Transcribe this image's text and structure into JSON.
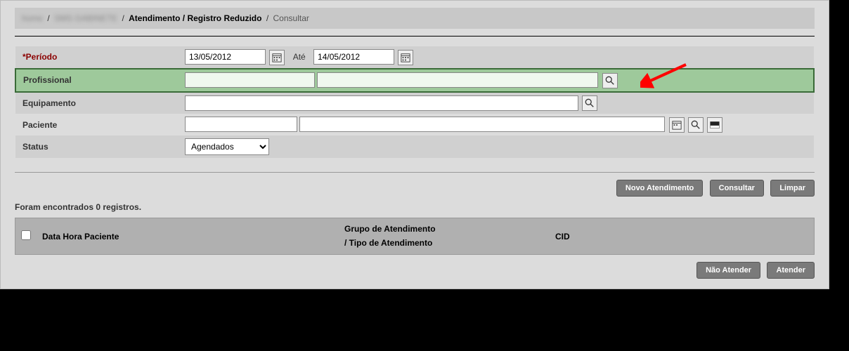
{
  "breadcrumb": {
    "item1_blur": "home",
    "item2_blur": "SMS GABINETE",
    "item3_bold": "Atendimento / Registro Reduzido",
    "item4": "Consultar"
  },
  "form": {
    "periodo": {
      "label": "*Período",
      "from": "13/05/2012",
      "ate_label": "Até",
      "to": "14/05/2012"
    },
    "profissional": {
      "label": "Profissional",
      "code": "",
      "name": ""
    },
    "equipamento": {
      "label": "Equipamento",
      "value": ""
    },
    "paciente": {
      "label": "Paciente",
      "code": "",
      "name": ""
    },
    "status": {
      "label": "Status",
      "selected": "Agendados",
      "options": [
        "Agendados"
      ]
    }
  },
  "buttons": {
    "novo": "Novo Atendimento",
    "consultar": "Consultar",
    "limpar": "Limpar",
    "nao_atender": "Não Atender",
    "atender": "Atender"
  },
  "results": {
    "count_label": "Foram encontrados 0 registros.",
    "headers": {
      "col1": "Data  Hora Paciente",
      "col2a": "Grupo de Atendimento",
      "col2b": "/ Tipo de Atendimento",
      "col3": "CID"
    }
  }
}
